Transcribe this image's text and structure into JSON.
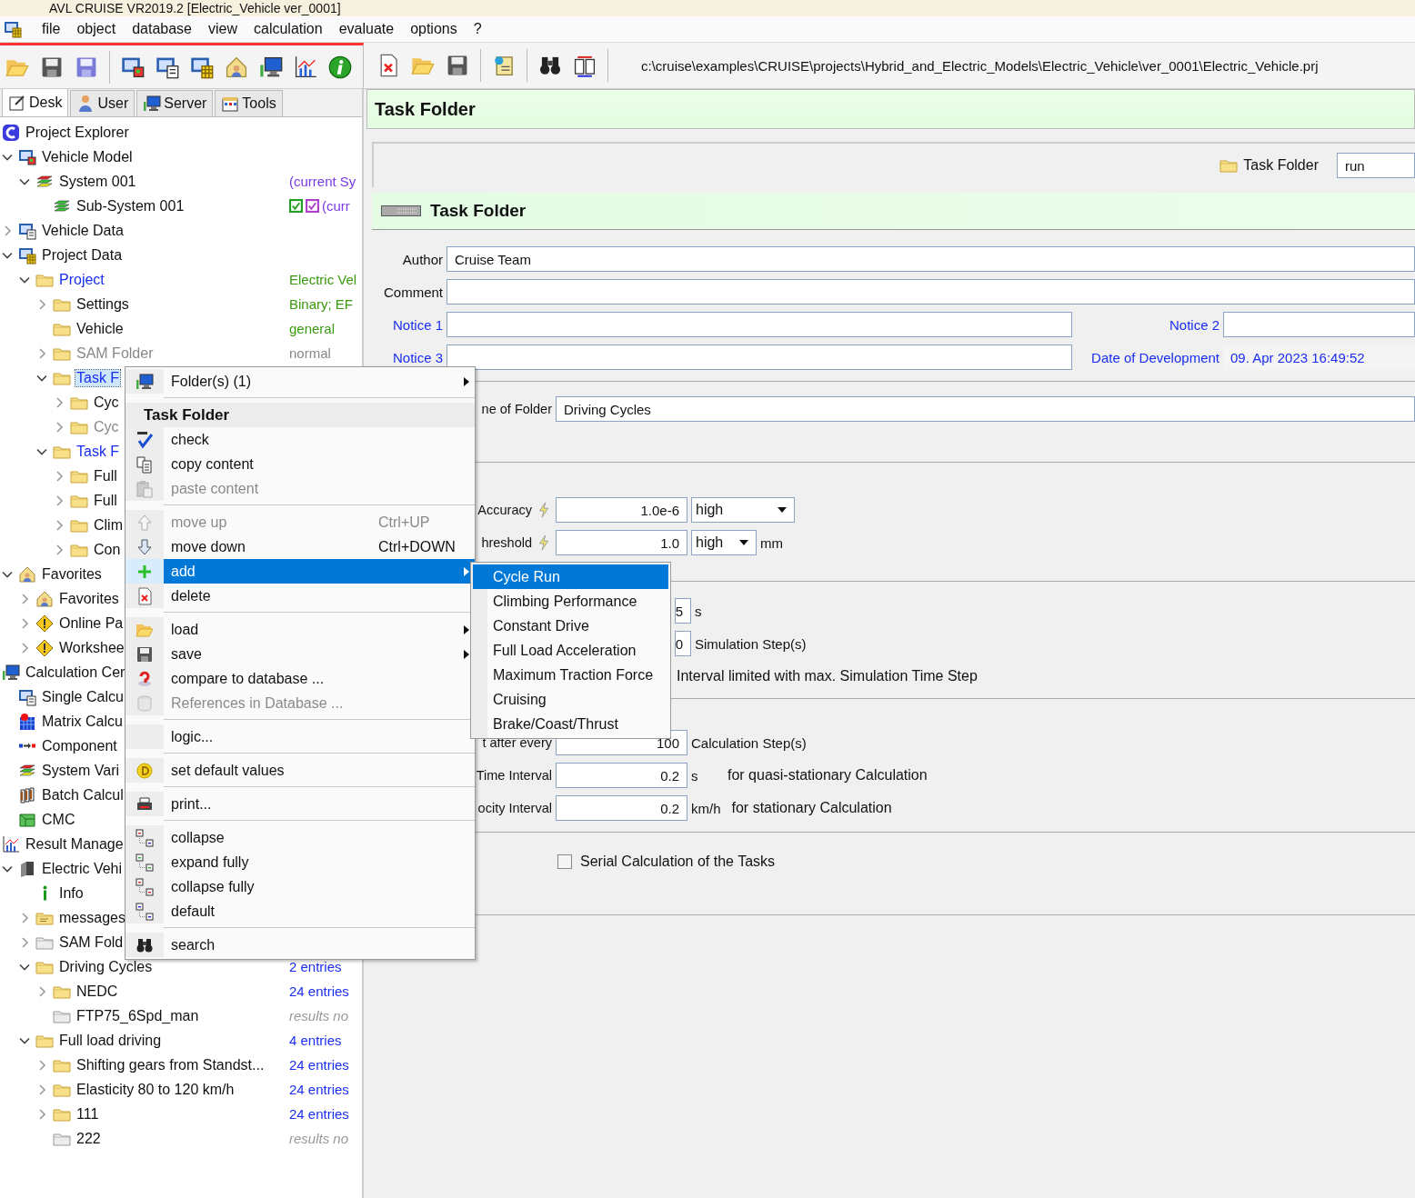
{
  "window": {
    "title": "AVL CRUISE VR2019.2 [Electric_Vehicle ver_0001]"
  },
  "menu": [
    "file",
    "object",
    "database",
    "view",
    "calculation",
    "evaluate",
    "options",
    "?"
  ],
  "toolbar": {
    "path": "c:\\cruise\\examples\\CRUISE\\projects\\Hybrid_and_Electric_Models\\Electric_Vehicle\\ver_0001\\Electric_Vehicle.prj"
  },
  "tabs": [
    {
      "label": "Desk",
      "selected": true
    },
    {
      "label": "User",
      "selected": false
    },
    {
      "label": "Server",
      "selected": false
    },
    {
      "label": "Tools",
      "selected": false
    }
  ],
  "tree": [
    {
      "label": "Project Explorer",
      "kind": "app-c",
      "selected": false,
      "children": [
        {
          "label": "Vehicle Model",
          "kind": "model",
          "expanded": true,
          "selected": false,
          "children": [
            {
              "label": "System 001",
              "kind": "layers",
              "expanded": true,
              "selected": false,
              "value": {
                "text": "(current Sy",
                "color": "#7a3ae8"
              },
              "children": [
                {
                  "label": "Sub-System 001",
                  "kind": "layers-green",
                  "selected": false,
                  "value": {
                    "text": "(curr",
                    "color": "#7a3ae8"
                  },
                  "checks": [
                    {
                      "checked": true,
                      "color": "#22a022"
                    },
                    {
                      "checked": true,
                      "color": "#b040d0"
                    }
                  ]
                }
              ]
            }
          ]
        },
        {
          "label": "Vehicle Data",
          "kind": "calc",
          "expanded": false,
          "selected": false
        },
        {
          "label": "Project Data",
          "kind": "model-db",
          "expanded": true,
          "selected": false,
          "children": [
            {
              "label": "Project",
              "kind": "folder",
              "expanded": true,
              "selected": false,
              "color": "#1a2ef0",
              "value": {
                "text": "Electric Vel",
                "color": "#3a9a10"
              },
              "children": [
                {
                  "label": "Settings",
                  "kind": "folder",
                  "expanded": false,
                  "selected": false,
                  "value": {
                    "text": "Binary; EF",
                    "color": "#3a9a10"
                  }
                },
                {
                  "label": "Vehicle",
                  "kind": "folder",
                  "selected": false,
                  "value": {
                    "text": "general",
                    "color": "#3a9a10"
                  }
                },
                {
                  "label": "SAM Folder",
                  "kind": "folder",
                  "expanded": false,
                  "selected": false,
                  "color": "#888888",
                  "value": {
                    "text": "normal",
                    "color": "#888888"
                  }
                },
                {
                  "label": "Task F",
                  "kind": "folder",
                  "expanded": true,
                  "selected": true,
                  "color": "#1a2ef0",
                  "children": [
                    {
                      "label": "Cyc",
                      "kind": "folder",
                      "expanded": false,
                      "selected": false
                    },
                    {
                      "label": "Cyc",
                      "kind": "folder",
                      "expanded": false,
                      "selected": false,
                      "color": "#888888"
                    }
                  ]
                },
                {
                  "label": "Task F",
                  "kind": "folder",
                  "expanded": true,
                  "selected": false,
                  "color": "#1a2ef0",
                  "children": [
                    {
                      "label": "Full",
                      "kind": "folder",
                      "expanded": false,
                      "selected": false
                    },
                    {
                      "label": "Full",
                      "kind": "folder",
                      "expanded": false,
                      "selected": false
                    },
                    {
                      "label": "Clim",
                      "kind": "folder",
                      "expanded": false,
                      "selected": false
                    },
                    {
                      "label": "Con",
                      "kind": "folder",
                      "expanded": false,
                      "selected": false
                    }
                  ]
                }
              ]
            }
          ]
        },
        {
          "label": "Favorites",
          "kind": "house",
          "expanded": true,
          "selected": false,
          "children": [
            {
              "label": "Favorites",
              "kind": "house",
              "expanded": false,
              "selected": false
            },
            {
              "label": "Online Pa",
              "kind": "warning",
              "expanded": false,
              "selected": false
            },
            {
              "label": "Workshee",
              "kind": "warning",
              "expanded": false,
              "selected": false
            }
          ]
        }
      ]
    },
    {
      "label": "Calculation Cer",
      "kind": "monitor",
      "selected": false,
      "children": [
        {
          "label": "Single Calcu",
          "kind": "calc",
          "selected": false
        },
        {
          "label": "Matrix Calcu",
          "kind": "matrix",
          "selected": false
        },
        {
          "label": "Component",
          "kind": "component",
          "selected": false
        },
        {
          "label": "System Vari",
          "kind": "layers",
          "selected": false
        },
        {
          "label": "Batch Calcul",
          "kind": "batch",
          "selected": false
        },
        {
          "label": "CMC",
          "kind": "cmc",
          "selected": false
        }
      ]
    },
    {
      "label": "Result Manage",
      "kind": "chart",
      "selected": false,
      "children": [
        {
          "label": "Electric Vehi",
          "kind": "book",
          "expanded": true,
          "selected": false,
          "children": [
            {
              "label": "Info",
              "kind": "info-i",
              "selected": false
            },
            {
              "label": "messages",
              "kind": "note",
              "expanded": false,
              "selected": false
            },
            {
              "label": "SAM Fold",
              "kind": "folder-grey",
              "expanded": false,
              "selected": false
            },
            {
              "label": "Driving Cycles",
              "kind": "folder",
              "expanded": true,
              "selected": false,
              "value": {
                "text": "2 entries",
                "color": "#1a2ef0"
              },
              "children": [
                {
                  "label": "NEDC",
                  "kind": "folder",
                  "expanded": false,
                  "selected": false,
                  "value": {
                    "text": "24 entries",
                    "color": "#1a2ef0"
                  }
                },
                {
                  "label": "FTP75_6Spd_man",
                  "kind": "folder-grey",
                  "selected": false,
                  "value": {
                    "text": "results no",
                    "color": "#999999",
                    "italic": true
                  }
                }
              ]
            },
            {
              "label": "Full load driving",
              "kind": "folder",
              "expanded": true,
              "selected": false,
              "value": {
                "text": "4 entries",
                "color": "#1a2ef0"
              },
              "children": [
                {
                  "label": "Shifting gears from Standst...",
                  "kind": "folder",
                  "expanded": false,
                  "selected": false,
                  "value": {
                    "text": "24 entries",
                    "color": "#1a2ef0"
                  }
                },
                {
                  "label": "Elasticity 80 to 120 km/h",
                  "kind": "folder",
                  "expanded": false,
                  "selected": false,
                  "value": {
                    "text": "24 entries",
                    "color": "#1a2ef0"
                  }
                },
                {
                  "label": "111",
                  "kind": "folder",
                  "expanded": false,
                  "selected": false,
                  "value": {
                    "text": "24 entries",
                    "color": "#1a2ef0"
                  }
                },
                {
                  "label": "222",
                  "kind": "folder-grey",
                  "selected": false,
                  "value": {
                    "text": "results no",
                    "color": "#999999",
                    "italic": true
                  }
                }
              ]
            }
          ]
        }
      ]
    }
  ],
  "content": {
    "title": "Task Folder",
    "folder_bar": {
      "label": "Task Folder",
      "value": "run"
    },
    "section_title": "Task Folder",
    "author": {
      "label": "Author",
      "value": "Cruise Team"
    },
    "comment": {
      "label": "Comment"
    },
    "notice_1": {
      "label": "Notice 1"
    },
    "notice_2": {
      "label": "Notice 2"
    },
    "notice_3": {
      "label": "Notice 3"
    },
    "date": {
      "label": "Date of Development",
      "value": "09. Apr 2023 16:49:52"
    },
    "folder_name": {
      "label": "ne of Folder",
      "value": "Driving Cycles"
    },
    "accuracy": {
      "label": "Accuracy",
      "value": "1.0e-6",
      "option": "high"
    },
    "threshold": {
      "label": "hreshold",
      "value": "1.0",
      "option": "high",
      "unit": "mm"
    },
    "step_rows": [
      {
        "value": "5",
        "unit": "s"
      },
      {
        "value": "0",
        "unit": "Simulation Step(s)"
      }
    ],
    "interval_note": "Interval limited with max. Simulation Time Step",
    "output_rows": [
      {
        "label": "t after every",
        "value": "100",
        "unit": "Calculation Step(s)"
      },
      {
        "label": "Time Interval",
        "value": "0.2",
        "unit": "s",
        "note": "for quasi-stationary Calculation"
      },
      {
        "label": "ocity Interval",
        "value": "0.2",
        "unit": "km/h",
        "note": "for stationary Calculation"
      }
    ],
    "serial": {
      "label": "Serial Calculation of the Tasks",
      "checked": false
    }
  },
  "context_menu": [
    {
      "kind": "monitor",
      "label": "Folder(s) (1)",
      "submenu": true,
      "disabled": false,
      "selected": false
    },
    {
      "kind": "separator"
    },
    {
      "kind": "header",
      "label": "Task Folder"
    },
    {
      "kind": "check-abc",
      "label": "check",
      "submenu": false,
      "disabled": false,
      "selected": false
    },
    {
      "kind": "copy",
      "label": "copy content",
      "submenu": false,
      "disabled": false,
      "selected": false
    },
    {
      "kind": "paste",
      "label": "paste content",
      "submenu": false,
      "disabled": true,
      "selected": false
    },
    {
      "kind": "separator"
    },
    {
      "kind": "arrow-up",
      "label": "move up",
      "shortcut": "Ctrl+UP",
      "submenu": false,
      "disabled": true,
      "selected": false
    },
    {
      "kind": "arrow-down",
      "label": "move down",
      "shortcut": "Ctrl+DOWN",
      "submenu": false,
      "disabled": false,
      "selected": false
    },
    {
      "kind": "plus",
      "label": "add",
      "submenu": true,
      "disabled": false,
      "selected": true
    },
    {
      "kind": "delete-doc",
      "label": "delete",
      "submenu": false,
      "disabled": false,
      "selected": false
    },
    {
      "kind": "separator"
    },
    {
      "kind": "folder-open",
      "label": "load",
      "submenu": true,
      "disabled": false,
      "selected": false
    },
    {
      "kind": "save",
      "label": "save",
      "submenu": true,
      "disabled": false,
      "selected": false
    },
    {
      "kind": "question",
      "label": "compare to database ...",
      "submenu": false,
      "disabled": false,
      "selected": false
    },
    {
      "kind": "database",
      "label": "References in Database ...",
      "submenu": false,
      "disabled": true,
      "selected": false
    },
    {
      "kind": "separator"
    },
    {
      "kind": "plain",
      "label": "logic...",
      "submenu": false,
      "disabled": false,
      "selected": false
    },
    {
      "kind": "separator"
    },
    {
      "kind": "coin",
      "label": "set default values",
      "submenu": false,
      "disabled": false,
      "selected": false
    },
    {
      "kind": "separator"
    },
    {
      "kind": "printer",
      "label": "print...",
      "submenu": false,
      "disabled": false,
      "selected": false
    },
    {
      "kind": "separator"
    },
    {
      "kind": "tree-collapse",
      "label": "collapse",
      "submenu": false,
      "disabled": false,
      "selected": false
    },
    {
      "kind": "tree-expand",
      "label": "expand fully",
      "submenu": false,
      "disabled": false,
      "selected": false
    },
    {
      "kind": "tree-collapse-all",
      "label": "collapse fully",
      "submenu": false,
      "disabled": false,
      "selected": false
    },
    {
      "kind": "tree-default",
      "label": "default",
      "submenu": false,
      "disabled": false,
      "selected": false
    },
    {
      "kind": "separator"
    },
    {
      "kind": "binoculars",
      "label": "search",
      "submenu": false,
      "disabled": false,
      "selected": false
    }
  ],
  "submenu": [
    {
      "label": "Cycle Run",
      "selected": true
    },
    {
      "label": "Climbing Performance",
      "selected": false
    },
    {
      "label": "Constant Drive",
      "selected": false
    },
    {
      "label": "Full Load Acceleration",
      "selected": false
    },
    {
      "label": "Maximum Traction Force",
      "selected": false
    },
    {
      "label": "Cruising",
      "selected": false
    },
    {
      "label": "Brake/Coast/Thrust",
      "selected": false
    }
  ]
}
